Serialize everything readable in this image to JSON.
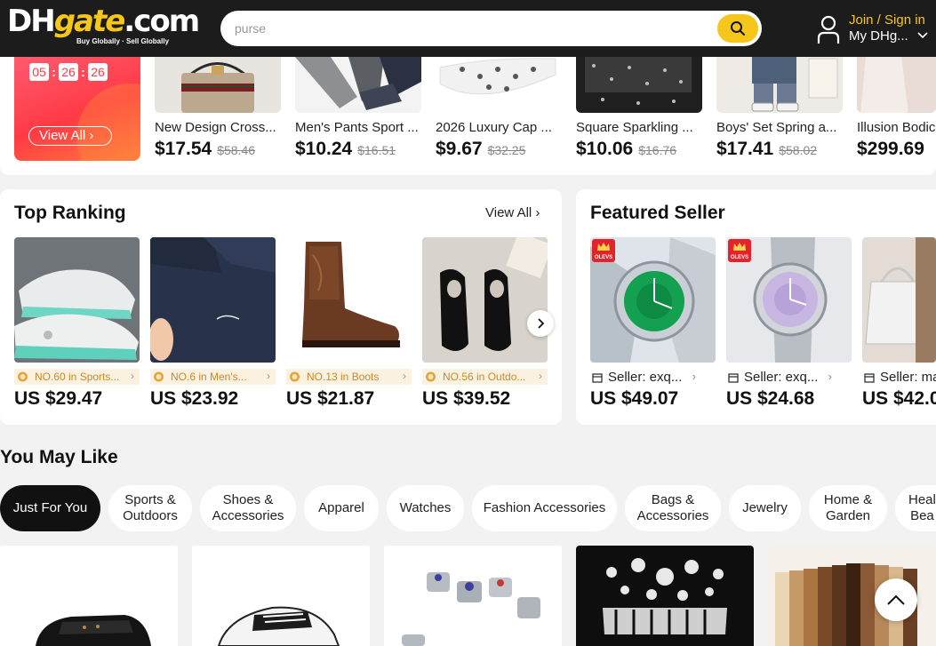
{
  "header": {
    "logo_main": "DHgate.com",
    "logo_dh": "DH",
    "logo_gate": "gate",
    "logo_com": ".com",
    "logo_tagline": "Buy Globally · Sell Globally",
    "search_value": "purse",
    "join_label": "Join / Sign in",
    "account_label": "My DHg...",
    "accent_color": "#f6c61b"
  },
  "flash_deals": {
    "timer": [
      "05",
      "26",
      "26"
    ],
    "view_all_label": "View All",
    "items": [
      {
        "name": "New Design Cross...",
        "price": "$17.54",
        "old_price": "$58.46"
      },
      {
        "name": "Men's Pants Sport ...",
        "price": "$10.24",
        "old_price": "$16.51"
      },
      {
        "name": "2026 Luxury Cap ...",
        "price": "$9.67",
        "old_price": "$32.25"
      },
      {
        "name": "Square Sparkling ...",
        "price": "$10.06",
        "old_price": "$16.76"
      },
      {
        "name": "Boys' Set Spring a...",
        "price": "$17.41",
        "old_price": "$58.02"
      },
      {
        "name": "Illusion Bodic",
        "price": "$299.69",
        "old_price": ""
      }
    ]
  },
  "top_ranking": {
    "title": "Top Ranking",
    "view_all_label": "View All",
    "items": [
      {
        "rank": "NO.60 in Sports...",
        "price": "US $29.47"
      },
      {
        "rank": "NO.6 in Men's...",
        "price": "US $23.92"
      },
      {
        "rank": "NO.13 in Boots",
        "price": "US $21.87"
      },
      {
        "rank": "NO.56 in Outdo...",
        "price": "US $39.52"
      }
    ]
  },
  "featured_seller": {
    "title": "Featured Seller",
    "badge_text": "OLEVS",
    "items": [
      {
        "seller": "Seller: exq...",
        "price": "US $49.07"
      },
      {
        "seller": "Seller: exq...",
        "price": "US $24.68"
      },
      {
        "seller": "Seller: ma",
        "price": "US $42.0"
      }
    ]
  },
  "you_may_like": {
    "title": "You May Like",
    "chips": [
      "Just For You",
      "Sports & Outdoors",
      "Shoes & Accessories",
      "Apparel",
      "Watches",
      "Fashion Accessories",
      "Bags & Accessories",
      "Jewelry",
      "Home & Garden",
      "Health & Beauty"
    ],
    "chip_lines": [
      [
        "Just For You"
      ],
      [
        "Sports &",
        "Outdoors"
      ],
      [
        "Shoes &",
        "Accessories"
      ],
      [
        "Apparel"
      ],
      [
        "Watches"
      ],
      [
        "Fashion Accessories"
      ],
      [
        "Bags &",
        "Accessories"
      ],
      [
        "Jewelry"
      ],
      [
        "Home &",
        "Garden"
      ],
      [
        "Heal",
        "Bea"
      ]
    ]
  }
}
